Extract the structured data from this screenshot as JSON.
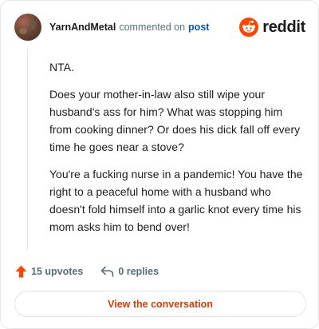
{
  "header": {
    "username": "YarnAndMetal",
    "verb": "commented on",
    "post_link": "post",
    "brand": "reddit"
  },
  "comment": {
    "paragraphs": [
      "NTA.",
      "Does your mother-in-law also still wipe your husband's ass for him? What was stopping him from cooking dinner? Or does his dick fall off every time he goes near a stove?",
      "You're a fucking nurse in a pandemic! You have the right to a peaceful home with a husband who doesn't fold himself into a garlic knot every time his mom asks him to bend over!"
    ]
  },
  "actions": {
    "upvotes": "15 upvotes",
    "replies": "0 replies"
  },
  "cta_label": "View the conversation",
  "colors": {
    "accent": "#ff4500",
    "link": "#0a55b8",
    "cta_text": "#d93a00"
  },
  "icons": [
    "avatar",
    "reddit-logo-icon",
    "upvote-arrow-icon",
    "reply-icon"
  ]
}
